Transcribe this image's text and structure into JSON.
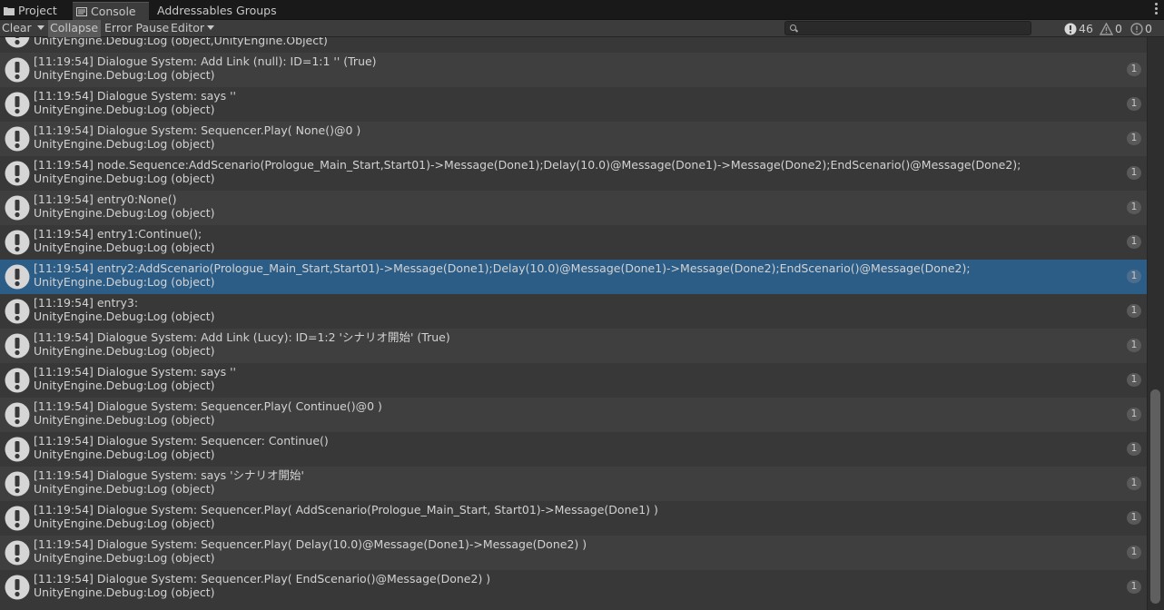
{
  "tabs": [
    {
      "label": "Project",
      "icon": "folder-icon"
    },
    {
      "label": "Console",
      "icon": "console-icon"
    },
    {
      "label": "Addressables Groups",
      "icon": ""
    }
  ],
  "toolbar": {
    "clear": "Clear",
    "collapse": "Collapse",
    "error_pause": "Error Pause",
    "editor": "Editor",
    "search_value": "",
    "counts": {
      "log": "46",
      "warning": "0",
      "error": "0"
    }
  },
  "colors": {
    "selected_row": "#2c5d87",
    "background": "#383838",
    "alt_row": "#3f3f3f"
  },
  "entries": [
    {
      "line1": "",
      "line2": "UnityEngine.Debug:Log (object,UnityEngine.Object)",
      "count": ""
    },
    {
      "line1": "[11:19:54] Dialogue System: Add Link (null): ID=1:1 '' (True)",
      "line2": "UnityEngine.Debug:Log (object)",
      "count": "1"
    },
    {
      "line1": "[11:19:54] Dialogue System:  says ''",
      "line2": "UnityEngine.Debug:Log (object)",
      "count": "1"
    },
    {
      "line1": "[11:19:54] Dialogue System: Sequencer.Play( None()@0 )",
      "line2": "UnityEngine.Debug:Log (object)",
      "count": "1"
    },
    {
      "line1": "[11:19:54] node.Sequence:AddScenario(Prologue_Main_Start,Start01)->Message(Done1);Delay(10.0)@Message(Done1)->Message(Done2);EndScenario()@Message(Done2);",
      "line2": "UnityEngine.Debug:Log (object)",
      "count": "1"
    },
    {
      "line1": "[11:19:54] entry0:None()",
      "line2": "UnityEngine.Debug:Log (object)",
      "count": "1"
    },
    {
      "line1": "[11:19:54] entry1:Continue();",
      "line2": "UnityEngine.Debug:Log (object)",
      "count": "1"
    },
    {
      "line1": "[11:19:54] entry2:AddScenario(Prologue_Main_Start,Start01)->Message(Done1);Delay(10.0)@Message(Done1)->Message(Done2);EndScenario()@Message(Done2);",
      "line2": "UnityEngine.Debug:Log (object)",
      "count": "1",
      "selected": true
    },
    {
      "line1": "[11:19:54] entry3:",
      "line2": "UnityEngine.Debug:Log (object)",
      "count": "1"
    },
    {
      "line1": "[11:19:54] Dialogue System: Add Link (Lucy): ID=1:2 'シナリオ開始' (True)",
      "line2": "UnityEngine.Debug:Log (object)",
      "count": "1"
    },
    {
      "line1": "[11:19:54] Dialogue System:  says ''",
      "line2": "UnityEngine.Debug:Log (object)",
      "count": "1"
    },
    {
      "line1": "[11:19:54] Dialogue System: Sequencer.Play( Continue()@0 )",
      "line2": "UnityEngine.Debug:Log (object)",
      "count": "1"
    },
    {
      "line1": "[11:19:54] Dialogue System: Sequencer: Continue()",
      "line2": "UnityEngine.Debug:Log (object)",
      "count": "1"
    },
    {
      "line1": "[11:19:54] Dialogue System:  says 'シナリオ開始'",
      "line2": "UnityEngine.Debug:Log (object)",
      "count": "1"
    },
    {
      "line1": "[11:19:54] Dialogue System: Sequencer.Play( AddScenario(Prologue_Main_Start, Start01)->Message(Done1) )",
      "line2": "UnityEngine.Debug:Log (object)",
      "count": "1"
    },
    {
      "line1": "[11:19:54] Dialogue System: Sequencer.Play( Delay(10.0)@Message(Done1)->Message(Done2) )",
      "line2": "UnityEngine.Debug:Log (object)",
      "count": "1"
    },
    {
      "line1": "[11:19:54] Dialogue System: Sequencer.Play( EndScenario()@Message(Done2) )",
      "line2": "UnityEngine.Debug:Log (object)",
      "count": "1"
    }
  ]
}
